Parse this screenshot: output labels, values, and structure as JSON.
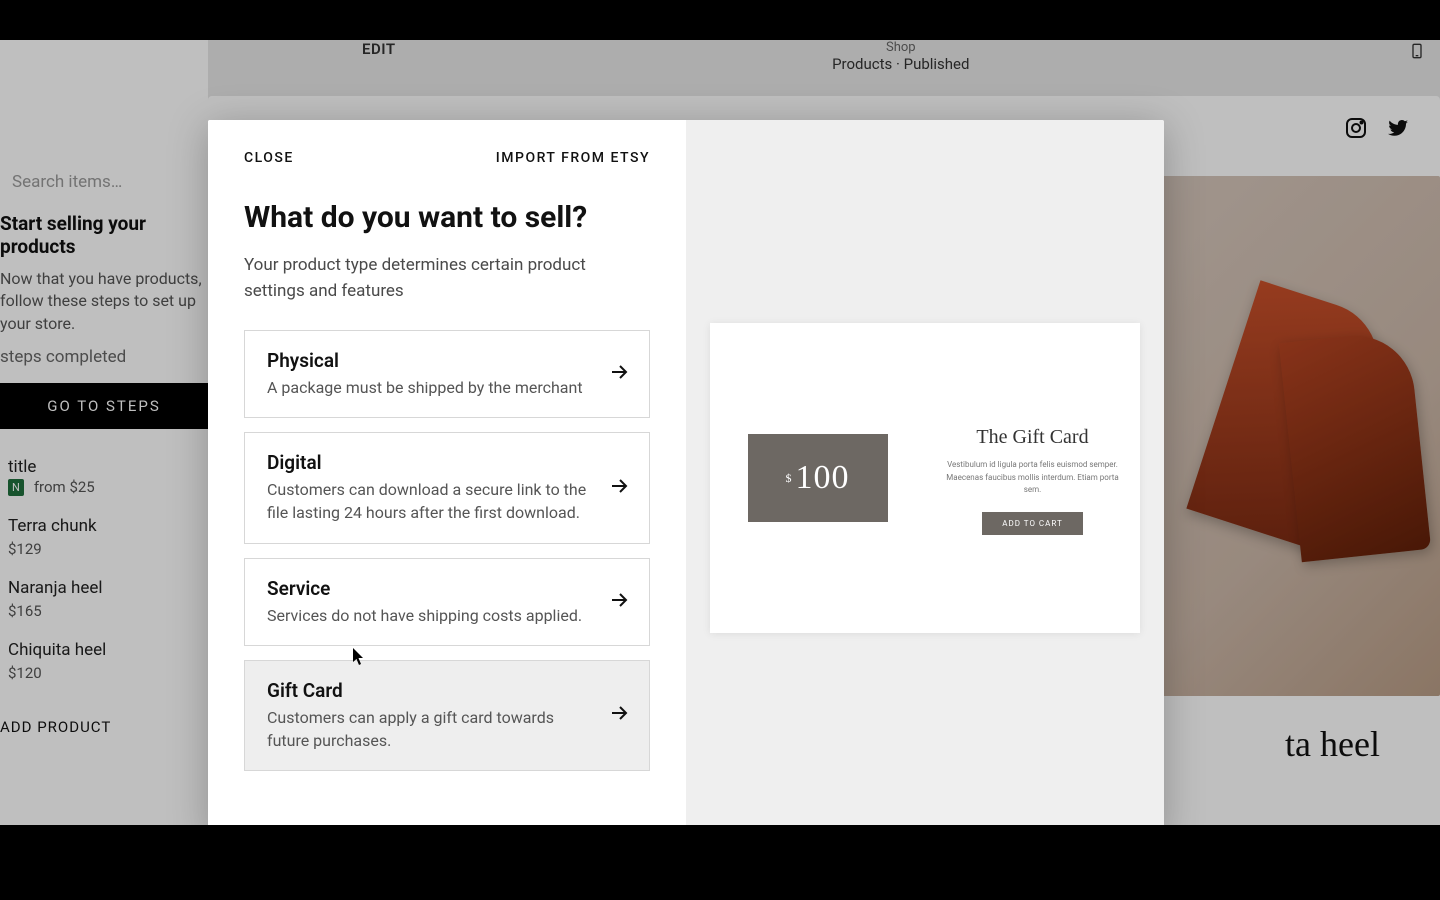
{
  "toolbar": {
    "edit_label": "EDIT",
    "shop_label": "Shop",
    "breadcrumb": "Products · Published"
  },
  "sidebar": {
    "search_placeholder": "Search items…",
    "start_heading": "Start selling your products",
    "start_body": "Now that you have products, follow these steps to set up your store.",
    "steps_completed": "steps completed",
    "go_to_steps": "GO TO STEPS",
    "featured": {
      "title": "title",
      "badge": "N",
      "price_prefix": "from",
      "price": "$25"
    },
    "products": [
      {
        "name": "Terra chunk",
        "price": "$129"
      },
      {
        "name": "Naranja heel",
        "price": "$165"
      },
      {
        "name": "Chiquita heel",
        "price": "$120"
      }
    ],
    "add_product": "ADD PRODUCT"
  },
  "site": {
    "hero_caption": "ta heel"
  },
  "modal": {
    "close": "CLOSE",
    "import": "IMPORT FROM ETSY",
    "title": "What do you want to sell?",
    "subtitle": "Your product type determines certain product settings and features",
    "options": [
      {
        "title": "Physical",
        "desc": "A package must be shipped by the merchant"
      },
      {
        "title": "Digital",
        "desc": "Customers can download a secure link to the file lasting 24 hours after the first download."
      },
      {
        "title": "Service",
        "desc": "Services do not have shipping costs applied."
      },
      {
        "title": "Gift Card",
        "desc": "Customers can apply a gift card towards future purchases."
      }
    ],
    "preview": {
      "gift_amount": "100",
      "gift_currency": "$",
      "card_title": "The Gift Card",
      "card_desc": "Vestibulum id ligula porta felis euismod semper. Maecenas faucibus mollis interdum. Etiam porta sem.",
      "add_to_cart": "ADD TO CART"
    }
  }
}
